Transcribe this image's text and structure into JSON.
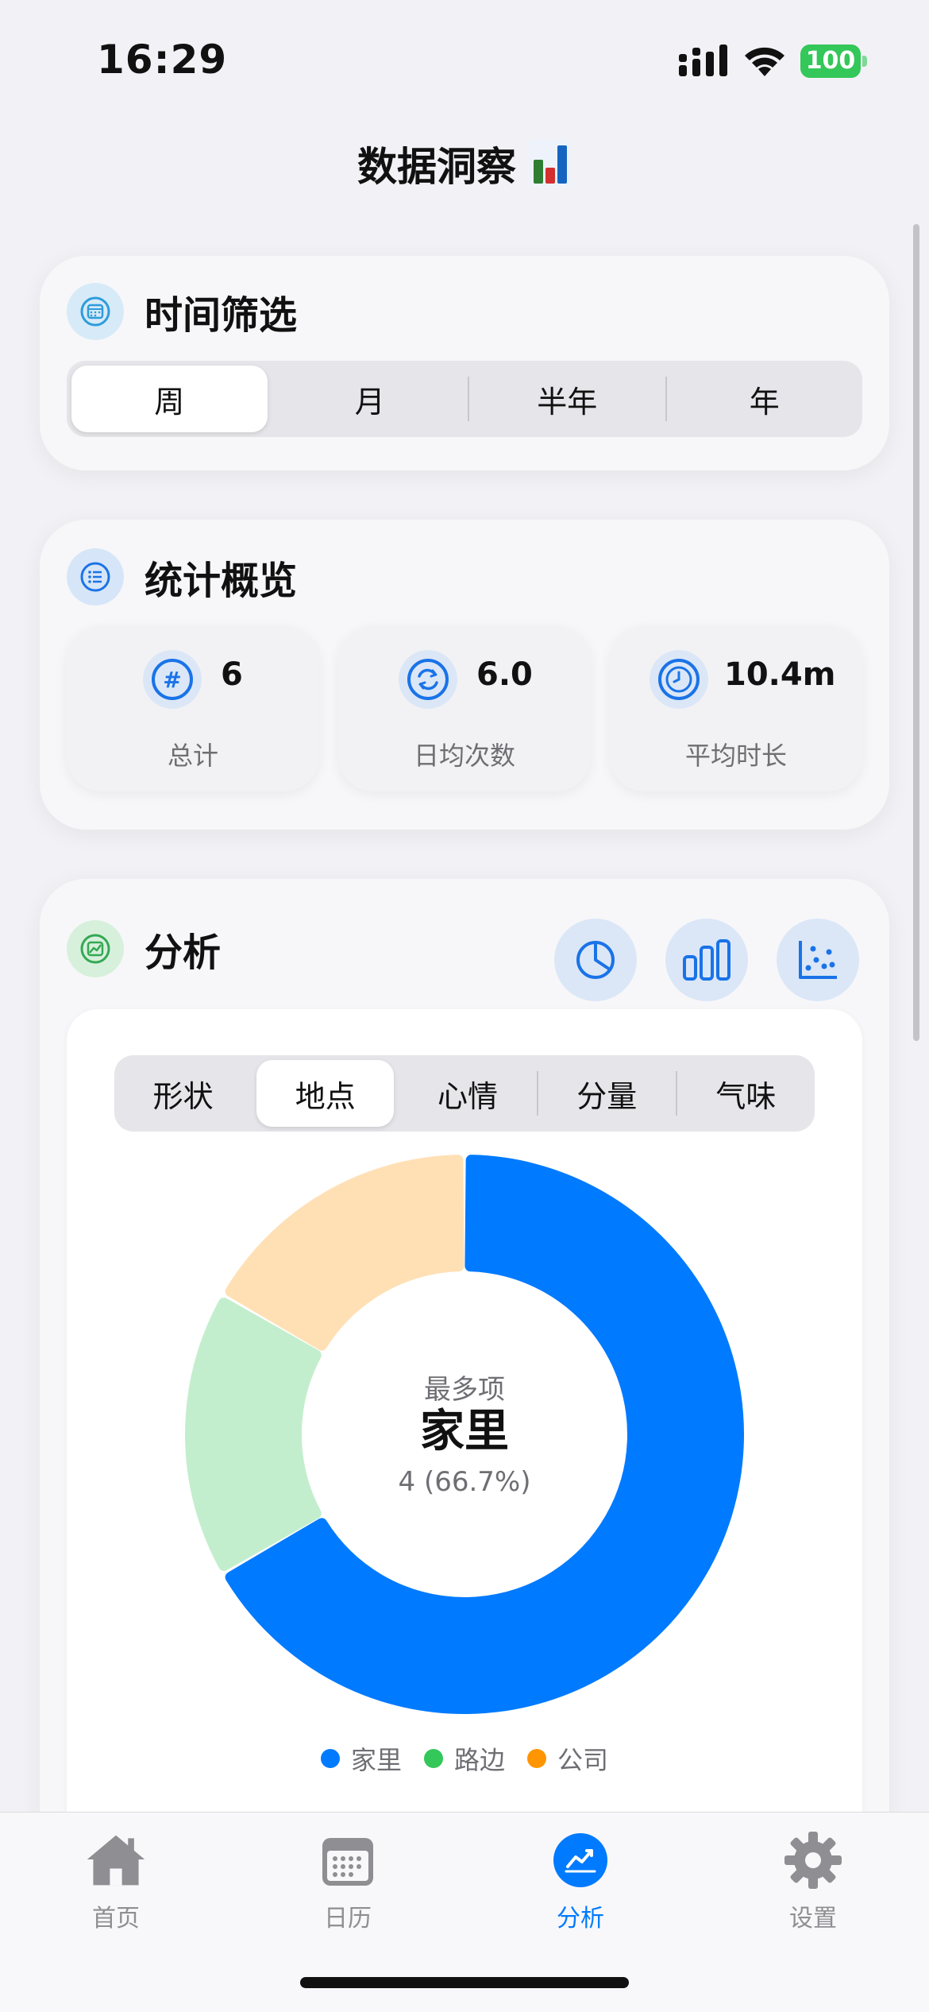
{
  "status": {
    "time": "16:29",
    "battery": "100"
  },
  "page": {
    "title": "数据洞察"
  },
  "filter": {
    "title": "时间筛选",
    "options": [
      "周",
      "月",
      "半年",
      "年"
    ],
    "selected": "周"
  },
  "overview": {
    "title": "统计概览",
    "stats": [
      {
        "value": "6",
        "label": "总计",
        "icon": "hash-icon"
      },
      {
        "value": "6.0",
        "label": "日均次数",
        "icon": "repeat-icon"
      },
      {
        "value": "10.4m",
        "label": "平均时长",
        "icon": "clock-icon"
      }
    ]
  },
  "analysis": {
    "title": "分析",
    "chart_buttons": [
      "pie-chart-icon",
      "bar-chart-icon",
      "scatter-chart-icon"
    ],
    "tabs": [
      "形状",
      "地点",
      "心情",
      "分量",
      "气味"
    ],
    "selected_tab": "地点",
    "center": {
      "caption": "最多项",
      "name": "家里",
      "detail": "4 (66.7%)"
    }
  },
  "chart_data": {
    "type": "pie",
    "categories": [
      "家里",
      "路边",
      "公司"
    ],
    "values": [
      4,
      1,
      1
    ],
    "colors": [
      "#007aff",
      "#34c759",
      "#ff9500"
    ],
    "legend": "bottom"
  },
  "tabbar": {
    "items": [
      {
        "label": "首页",
        "icon": "house-icon"
      },
      {
        "label": "日历",
        "icon": "calendar-icon"
      },
      {
        "label": "分析",
        "icon": "analytics-icon"
      },
      {
        "label": "设置",
        "icon": "gear-icon"
      }
    ],
    "active": 2
  }
}
